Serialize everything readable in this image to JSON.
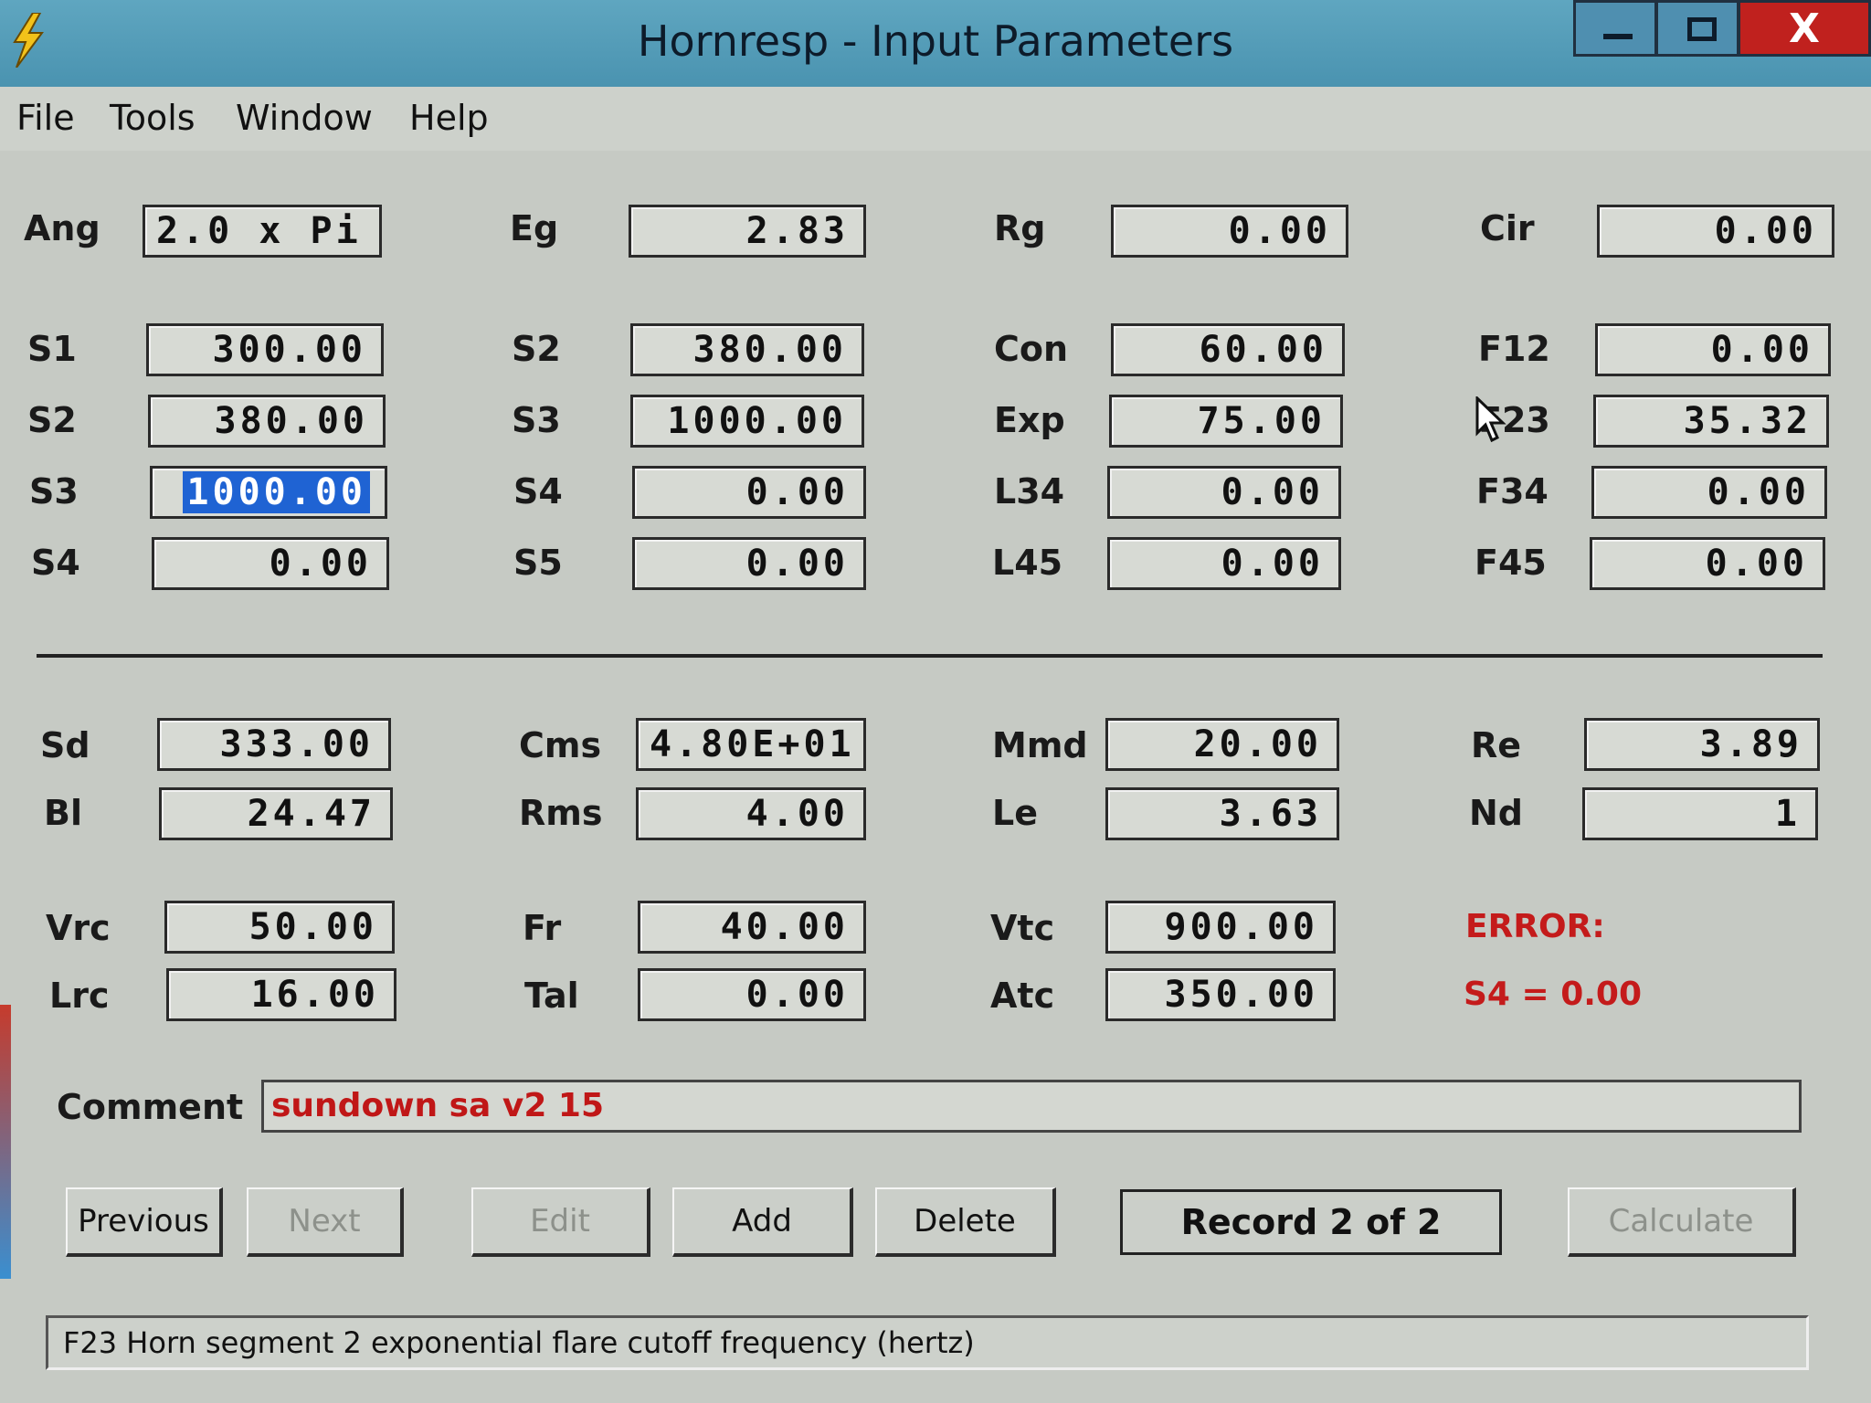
{
  "window": {
    "title": "Hornresp - Input Parameters",
    "close_label": "X"
  },
  "menu": [
    "File",
    "Tools",
    "Window",
    "Help"
  ],
  "top_fields": {
    "ang": {
      "label": "Ang",
      "value": "2.0 x Pi"
    },
    "eg": {
      "label": "Eg",
      "value": "2.83"
    },
    "rg": {
      "label": "Rg",
      "value": "0.00"
    },
    "cir": {
      "label": "Cir",
      "value": "0.00"
    }
  },
  "horn_rows": [
    {
      "c1_label": "S1",
      "c1_value": "300.00",
      "c2_label": "S2",
      "c2_value": "380.00",
      "c3_label": "Con",
      "c3_value": "60.00",
      "c4_label": "F12",
      "c4_value": "0.00"
    },
    {
      "c1_label": "S2",
      "c1_value": "380.00",
      "c2_label": "S3",
      "c2_value": "1000.00",
      "c3_label": "Exp",
      "c3_value": "75.00",
      "c4_label": "F23",
      "c4_value": "35.32"
    },
    {
      "c1_label": "S3",
      "c1_value": "1000.00",
      "c2_label": "S4",
      "c2_value": "0.00",
      "c3_label": "L34",
      "c3_value": "0.00",
      "c4_label": "F34",
      "c4_value": "0.00"
    },
    {
      "c1_label": "S4",
      "c1_value": "0.00",
      "c2_label": "S5",
      "c2_value": "0.00",
      "c3_label": "L45",
      "c3_value": "0.00",
      "c4_label": "F45",
      "c4_value": "0.00"
    }
  ],
  "driver_rows": [
    {
      "c1_label": "Sd",
      "c1_value": "333.00",
      "c2_label": "Cms",
      "c2_value": "4.80E+01",
      "c3_label": "Mmd",
      "c3_value": "20.00",
      "c4_label": "Re",
      "c4_value": "3.89"
    },
    {
      "c1_label": "Bl",
      "c1_value": "24.47",
      "c2_label": "Rms",
      "c2_value": "4.00",
      "c3_label": "Le",
      "c3_value": "3.63",
      "c4_label": "Nd",
      "c4_value": "1"
    },
    {
      "c1_label": "Vrc",
      "c1_value": "50.00",
      "c2_label": "Fr",
      "c2_value": "40.00",
      "c3_label": "Vtc",
      "c3_value": "900.00"
    },
    {
      "c1_label": "Lrc",
      "c1_value": "16.00",
      "c2_label": "Tal",
      "c2_value": "0.00",
      "c3_label": "Atc",
      "c3_value": "350.00"
    }
  ],
  "error": {
    "title": "ERROR:",
    "message": "S4 = 0.00"
  },
  "comment": {
    "label": "Comment",
    "value": "sundown sa v2 15"
  },
  "buttons": {
    "previous": "Previous",
    "next": "Next",
    "edit": "Edit",
    "add": "Add",
    "delete": "Delete",
    "record": "Record 2 of 2",
    "calculate": "Calculate"
  },
  "status": "F23  Horn segment 2 exponential flare cutoff frequency  (hertz)",
  "icons": {
    "app": "lightning-bolt-icon",
    "cursor": "mouse-pointer-icon"
  },
  "colors": {
    "titlebar": "#4a93b0",
    "close": "#c0211e",
    "error": "#c41b1b",
    "selection": "#1f63d3"
  }
}
